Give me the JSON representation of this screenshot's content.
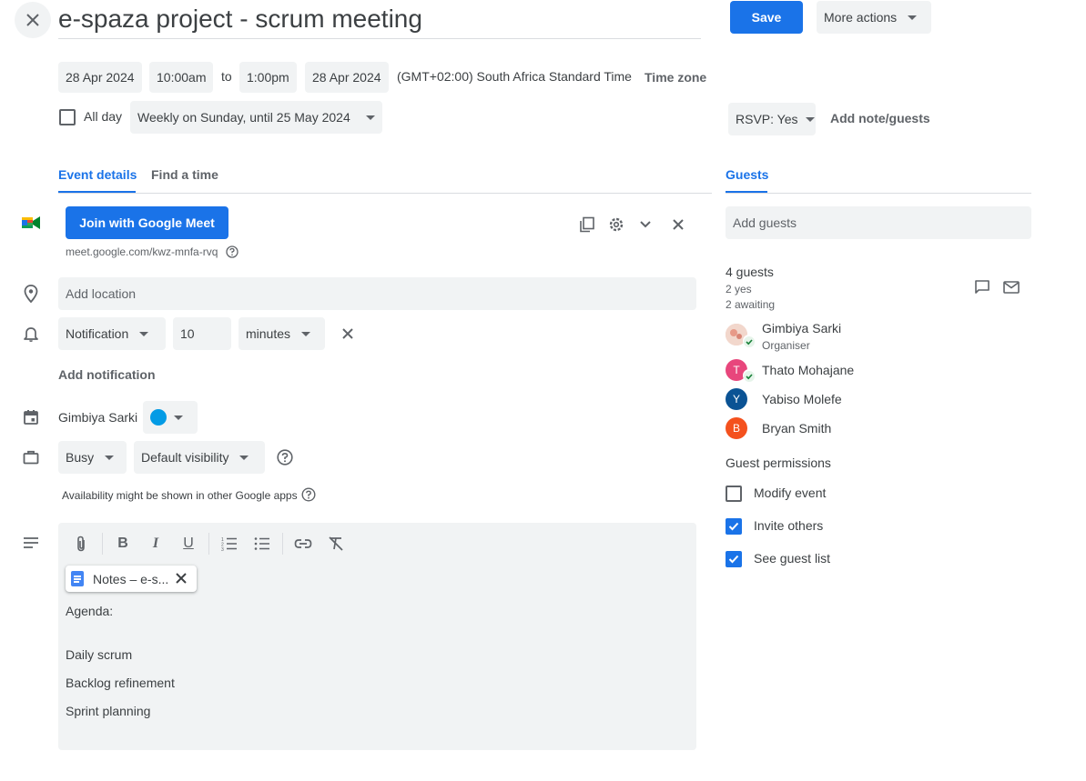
{
  "header": {
    "title": "e-spaza project - scrum meeting",
    "save_label": "Save",
    "more_actions_label": "More actions"
  },
  "datetime": {
    "start_date": "28 Apr 2024",
    "start_time": "10:00am",
    "to_label": "to",
    "end_time": "1:00pm",
    "end_date": "28 Apr 2024",
    "timezone_text": "(GMT+02:00) South Africa Standard Time",
    "timezone_button": "Time zone",
    "all_day_label": "All day",
    "all_day_checked": false,
    "recurrence": "Weekly on Sunday, until 25 May 2024"
  },
  "rsvp": {
    "label": "RSVP: Yes",
    "add_note_label": "Add note/guests"
  },
  "tabs": {
    "event_details": "Event details",
    "find_time": "Find a time",
    "guests": "Guests"
  },
  "meet": {
    "join_label": "Join with Google Meet",
    "link": "meet.google.com/kwz-mnfa-rvq"
  },
  "location": {
    "placeholder": "Add location"
  },
  "notification": {
    "type": "Notification",
    "amount": "10",
    "unit": "minutes",
    "add_label": "Add notification"
  },
  "calendar": {
    "owner": "Gimbiya Sarki",
    "color": "#039be5"
  },
  "status": {
    "busy": "Busy",
    "visibility": "Default visibility",
    "availability_note": "Availability might be shown in other Google apps"
  },
  "description": {
    "attachment_name": "Notes – e-s...",
    "lines": [
      "Agenda:",
      "",
      "Daily scrum",
      "Backlog refinement",
      "Sprint planning"
    ]
  },
  "guests": {
    "add_placeholder": "Add guests",
    "count_label": "4 guests",
    "yes_label": "2 yes",
    "awaiting_label": "2 awaiting",
    "list": [
      {
        "name": "Gimbiya Sarki",
        "role": "Organiser",
        "initial": "",
        "color": "#e8c4b8",
        "accepted": true
      },
      {
        "name": "Thato Mohajane",
        "role": "",
        "initial": "T",
        "color": "#e8467c",
        "accepted": true
      },
      {
        "name": "Yabiso Molefe",
        "role": "",
        "initial": "Y",
        "color": "#0b5394",
        "accepted": false
      },
      {
        "name": "Bryan Smith",
        "role": "",
        "initial": "B",
        "color": "#f4511e",
        "accepted": false
      }
    ],
    "permissions_title": "Guest permissions",
    "permissions": [
      {
        "label": "Modify event",
        "checked": false
      },
      {
        "label": "Invite others",
        "checked": true
      },
      {
        "label": "See guest list",
        "checked": true
      }
    ]
  },
  "colors": {
    "accent": "#1a73e8",
    "chip_bg": "#f1f3f4",
    "text": "#3c4043",
    "secondary": "#5f6368"
  }
}
